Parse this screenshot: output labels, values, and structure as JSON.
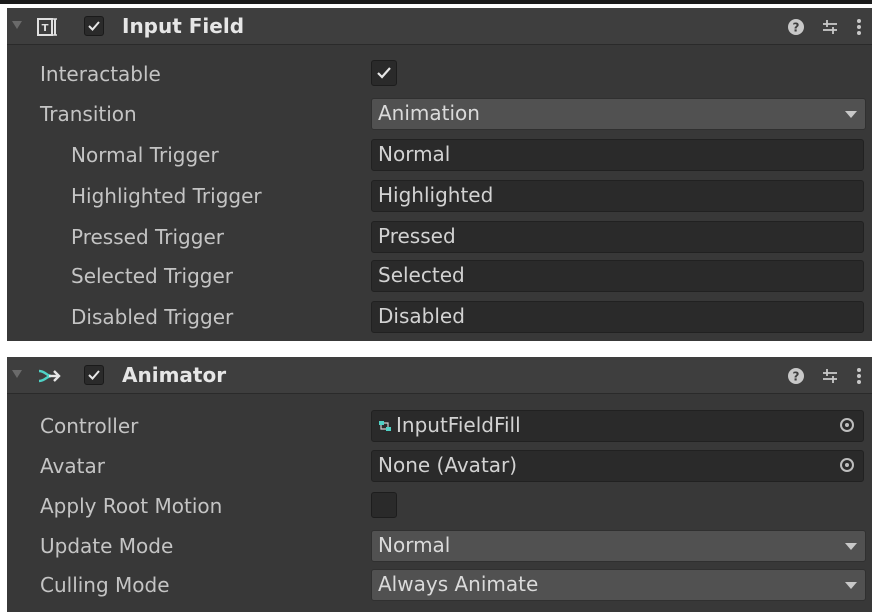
{
  "input_field": {
    "title": "Input Field",
    "enabled": true,
    "icon": "input-field-icon",
    "header_icons": [
      "help-icon",
      "preset-icon",
      "more-icon"
    ],
    "rows": [
      {
        "label": "Interactable",
        "type": "checkbox",
        "checked": true
      },
      {
        "label": "Transition",
        "type": "dropdown",
        "value": "Animation"
      },
      {
        "label": "Normal Trigger",
        "type": "text",
        "value": "Normal"
      },
      {
        "label": "Highlighted Trigger",
        "type": "text",
        "value": "Highlighted"
      },
      {
        "label": "Pressed Trigger",
        "type": "text",
        "value": "Pressed"
      },
      {
        "label": "Selected Trigger",
        "type": "text",
        "value": "Selected"
      },
      {
        "label": "Disabled Trigger",
        "type": "text",
        "value": "Disabled"
      }
    ]
  },
  "animator": {
    "title": "Animator",
    "enabled": true,
    "icon": "animator-icon",
    "header_icons": [
      "help-icon",
      "preset-icon",
      "more-icon"
    ],
    "rows": [
      {
        "label": "Controller",
        "type": "object",
        "value": "InputFieldFill",
        "icon": "animator-controller-icon"
      },
      {
        "label": "Avatar",
        "type": "object",
        "value": "None (Avatar)"
      },
      {
        "label": "Apply Root Motion",
        "type": "checkbox",
        "checked": false
      },
      {
        "label": "Update Mode",
        "type": "dropdown",
        "value": "Normal"
      },
      {
        "label": "Culling Mode",
        "type": "dropdown",
        "value": "Always Animate"
      }
    ]
  },
  "colors": {
    "panel_bg": "#383838",
    "header_bg": "#3e3e3e",
    "field_bg": "#2a2a2a",
    "dropdown_bg": "#515151",
    "text": "#c4c4c4",
    "accent_teal": "#4fd1c5"
  }
}
